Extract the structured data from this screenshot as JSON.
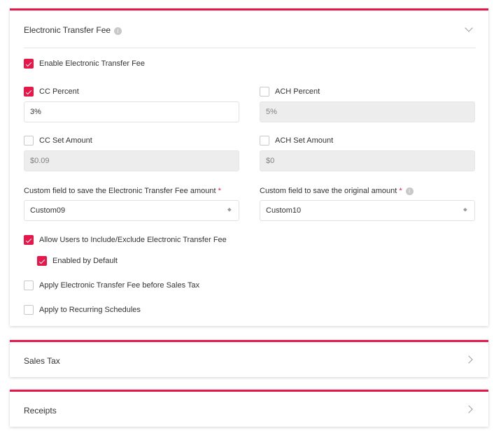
{
  "electronic_transfer_fee": {
    "title": "Electronic Transfer Fee",
    "info_glyph": "i",
    "enable_label": "Enable Electronic Transfer Fee",
    "enable_checked": true,
    "cc_percent": {
      "label": "CC Percent",
      "checked": true,
      "value": "3%"
    },
    "ach_percent": {
      "label": "ACH Percent",
      "checked": false,
      "value": "5%"
    },
    "cc_set_amount": {
      "label": "CC Set Amount",
      "checked": false,
      "value": "$0.09"
    },
    "ach_set_amount": {
      "label": "ACH Set Amount",
      "checked": false,
      "value": "$0"
    },
    "custom_fee_field": {
      "label": "Custom field to save the Electronic Transfer Fee amount",
      "required_mark": "*",
      "value": "Custom09"
    },
    "custom_original_field": {
      "label": "Custom field to save the original amount",
      "required_mark": "*",
      "value": "Custom10"
    },
    "allow_users": {
      "label": "Allow Users to Include/Exclude Electronic Transfer Fee",
      "checked": true
    },
    "enabled_by_default": {
      "label": "Enabled by Default",
      "checked": true
    },
    "apply_before_tax": {
      "label": "Apply Electronic Transfer Fee before Sales Tax",
      "checked": false
    },
    "apply_recurring": {
      "label": "Apply to Recurring Schedules",
      "checked": false
    }
  },
  "sales_tax": {
    "title": "Sales Tax"
  },
  "receipts": {
    "title": "Receipts"
  },
  "colors": {
    "accent": "#e8174a",
    "disabled_bg": "#ededed",
    "text": "#333333"
  },
  "icons": {
    "collapse": "chevron-down-icon",
    "expand": "chevron-right-icon",
    "info": "info-icon",
    "select": "select-arrows-icon"
  }
}
